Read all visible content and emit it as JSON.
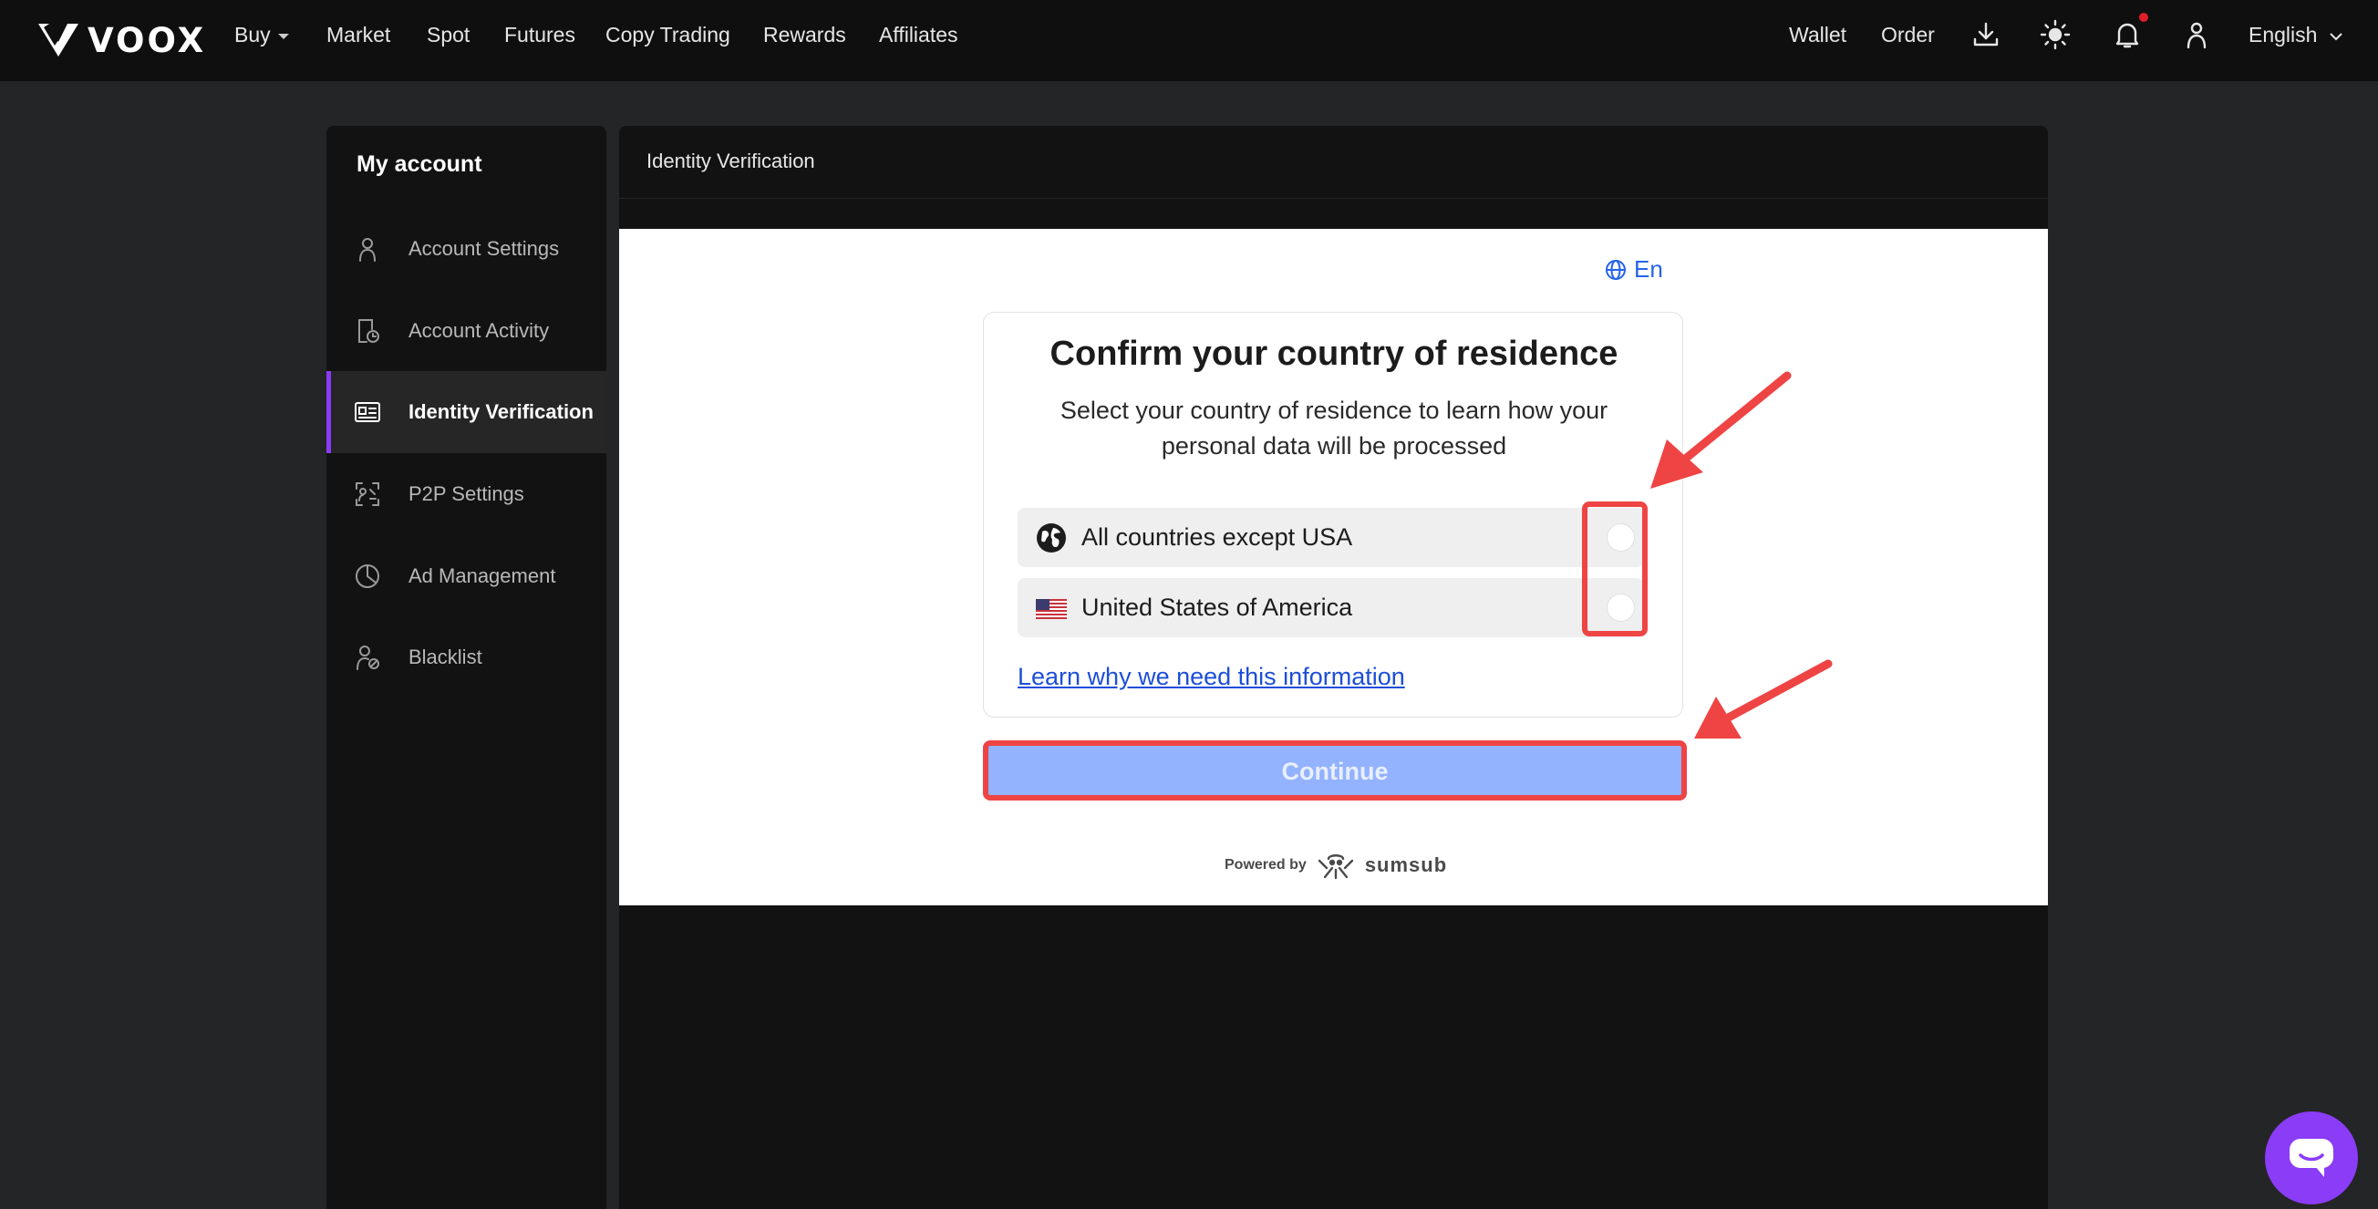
{
  "brand": {
    "name": "VOOX"
  },
  "topnav": {
    "left_items": [
      {
        "label": "Buy",
        "has_caret": true
      },
      {
        "label": "Market"
      },
      {
        "label": "Spot"
      },
      {
        "label": "Futures"
      },
      {
        "label": "Copy Trading"
      },
      {
        "label": "Rewards"
      },
      {
        "label": "Affiliates"
      }
    ],
    "wallet_label": "Wallet",
    "order_label": "Order",
    "icons": [
      "download-icon",
      "theme-sun-icon",
      "bell-icon",
      "user-icon"
    ],
    "has_notification": true,
    "language_label": "English"
  },
  "sidebar": {
    "title": "My account",
    "items": [
      {
        "label": "Account Settings",
        "icon": "person-icon",
        "active": false
      },
      {
        "label": "Account Activity",
        "icon": "activity-icon",
        "active": false
      },
      {
        "label": "Identity Verification",
        "icon": "id-card-icon",
        "active": true
      },
      {
        "label": "P2P Settings",
        "icon": "p2p-icon",
        "active": false
      },
      {
        "label": "Ad Management",
        "icon": "pie-chart-icon",
        "active": false
      },
      {
        "label": "Blacklist",
        "icon": "blacklist-icon",
        "active": false
      }
    ]
  },
  "panel": {
    "title": "Identity Verification"
  },
  "verification": {
    "language_label": "En",
    "title": "Confirm your country of residence",
    "subtitle": "Select your country of residence to learn how your personal data will be processed",
    "options": [
      {
        "label": "All countries except USA",
        "icon": "globe-icon",
        "selected": false
      },
      {
        "label": "United States of America",
        "icon": "us-flag-icon",
        "selected": false
      }
    ],
    "learn_link": "Learn why we need this information",
    "continue_label": "Continue",
    "powered_by": "Powered by",
    "provider": "sumsub"
  },
  "colors": {
    "accent_purple": "#8b3cf6",
    "link_blue": "#1d4ed8",
    "continue_disabled": "#93b2ff",
    "annotation_red": "#ef4444"
  }
}
